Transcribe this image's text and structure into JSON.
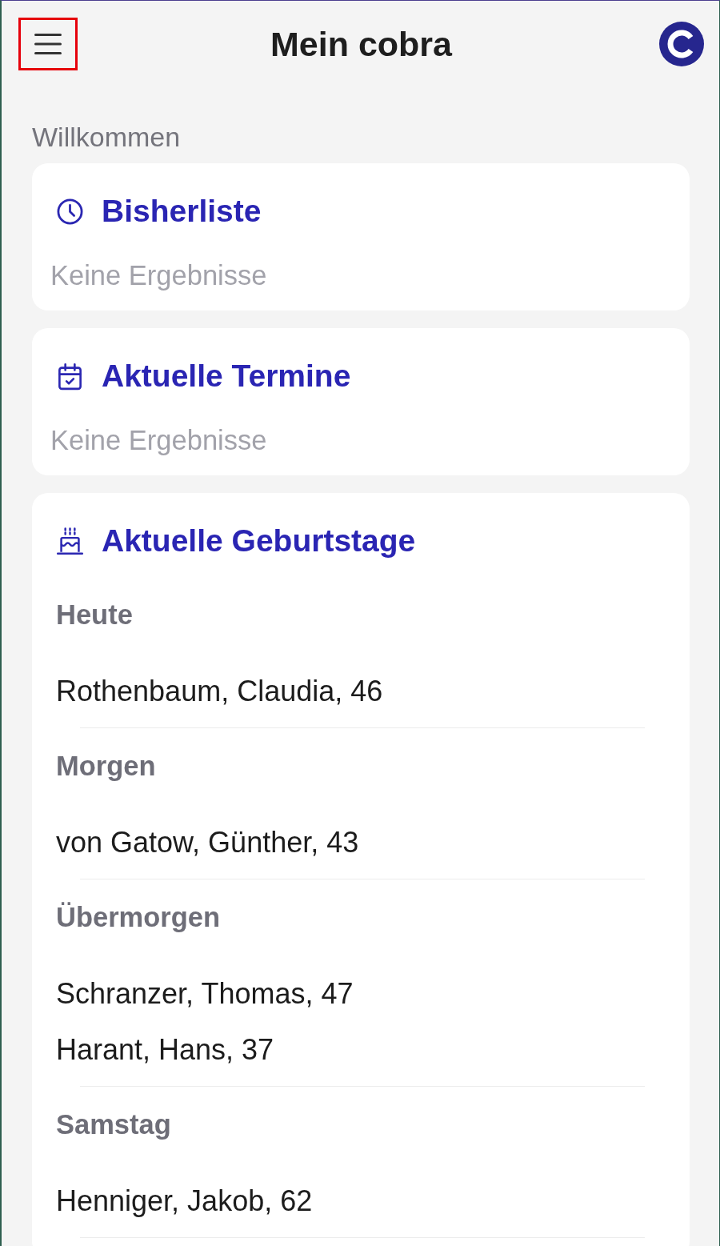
{
  "header": {
    "menu_button": {
      "highlighted": true
    },
    "title": "Mein cobra"
  },
  "section_label": "Willkommen",
  "cards": [
    {
      "kind": "empty",
      "title": "Bisherliste",
      "message": "Keine Ergebnisse"
    },
    {
      "kind": "empty",
      "title": "Aktuelle Termine",
      "message": "Keine Ergebnisse"
    },
    {
      "kind": "groups",
      "title": "Aktuelle Geburtstage",
      "groups": [
        {
          "heading": "Heute",
          "entries": [
            "Rothenbaum, Claudia, 46"
          ]
        },
        {
          "heading": "Morgen",
          "entries": [
            "von Gatow, Günther, 43"
          ]
        },
        {
          "heading": "Übermorgen",
          "entries": [
            "Schranzer, Thomas, 47",
            "Harant, Hans, 37"
          ]
        },
        {
          "heading": "Samstag",
          "entries": [
            "Henniger, Jakob, 62"
          ]
        }
      ]
    }
  ]
}
